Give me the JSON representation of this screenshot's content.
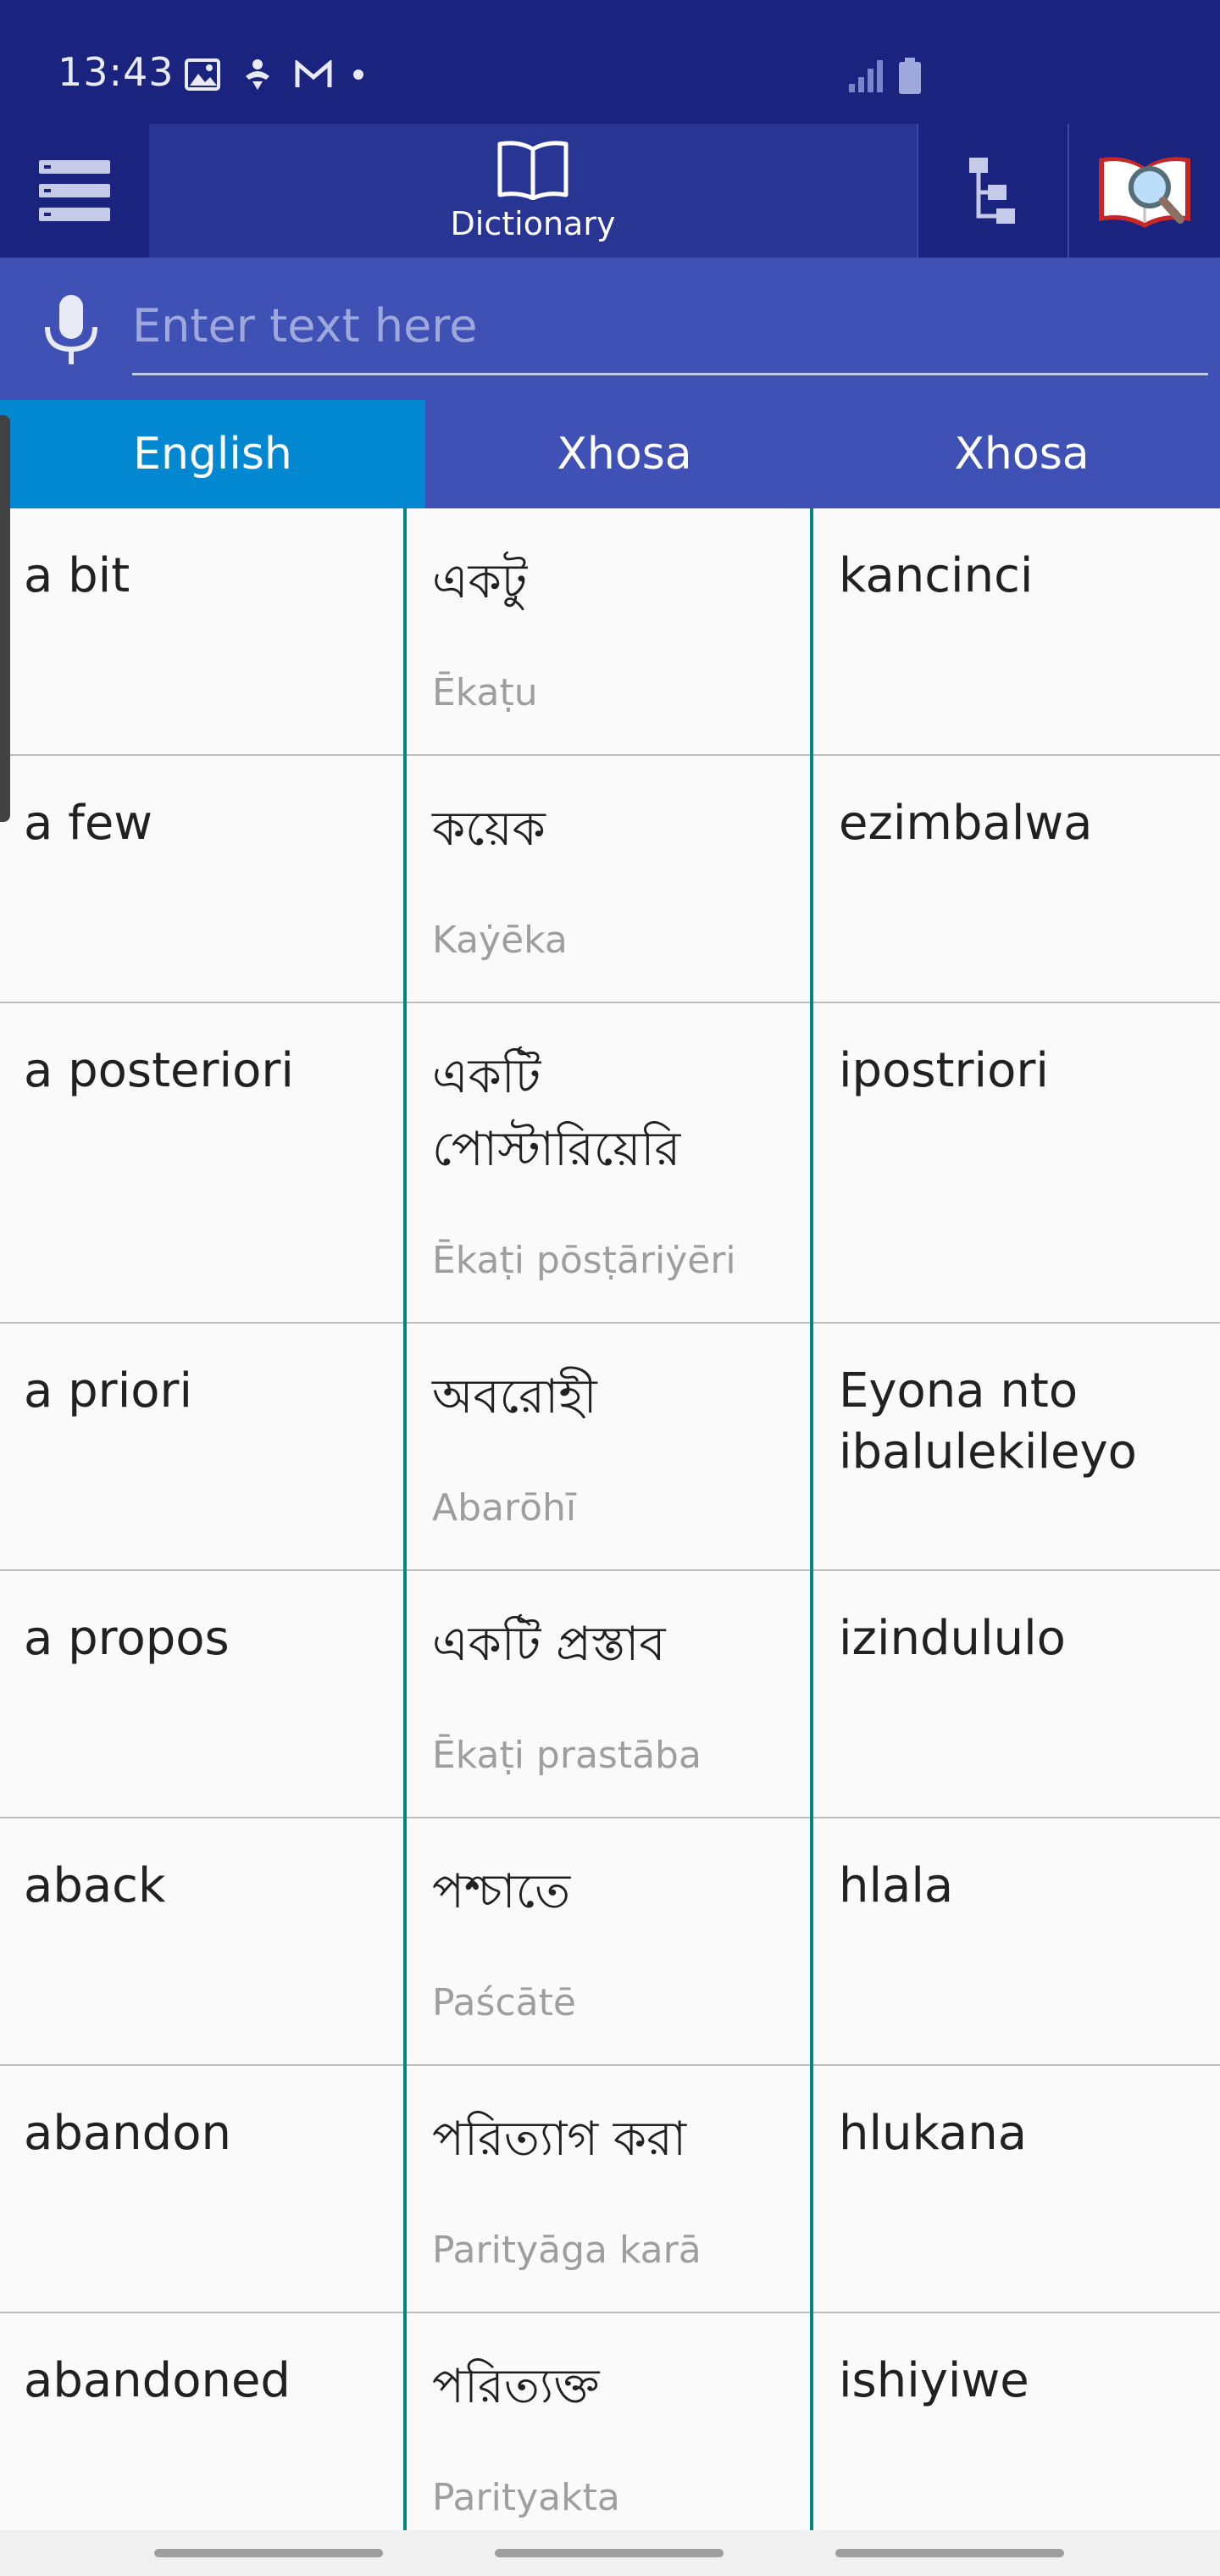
{
  "status_bar": {
    "time": "13:43",
    "left_icons": [
      "image-icon",
      "accessibility-icon",
      "gmail-icon",
      "dot-icon"
    ],
    "right_icons": [
      "signal-icon",
      "battery-icon"
    ]
  },
  "toolbar": {
    "menu_icon": "menu-icon",
    "dictionary_label": "Dictionary",
    "dictionary_icon": "book-icon",
    "tree_icon": "tree-icon",
    "lookup_icon": "book-magnifier-icon"
  },
  "search": {
    "placeholder": "Enter text here",
    "value": "",
    "mic_icon": "mic-icon"
  },
  "languages": [
    {
      "label": "English",
      "active": true
    },
    {
      "label": "Xhosa",
      "active": false
    },
    {
      "label": "Xhosa",
      "active": false
    }
  ],
  "rows": [
    {
      "english": "a bit",
      "bengali": "একটু",
      "translit": "Ēkaṭu",
      "xhosa": "kancinci"
    },
    {
      "english": "a few",
      "bengali": "কয়েক",
      "translit": "Kaẏēka",
      "xhosa": "ezimbalwa"
    },
    {
      "english": "a posteriori",
      "bengali": "একটি\nপোস্টারিয়েরি",
      "translit": "Ēkaṭi pōsṭāriẏēri",
      "xhosa": "ipostriori"
    },
    {
      "english": "a priori",
      "bengali": "অবরোহী",
      "translit": "Abarōhī",
      "xhosa": "Eyona nto ibalulekileyo"
    },
    {
      "english": "a propos",
      "bengali": "একটি প্রস্তাব",
      "translit": "Ēkaṭi prastāba",
      "xhosa": "izindululo"
    },
    {
      "english": "aback",
      "bengali": "পশ্চাতে",
      "translit": "Paścātē",
      "xhosa": "hlala"
    },
    {
      "english": "abandon",
      "bengali": "পরিত্যাগ করা",
      "translit": "Parityāga karā",
      "xhosa": "hlukana"
    },
    {
      "english": "abandoned",
      "bengali": "পরিত্যক্ত",
      "translit": "Parityakta",
      "xhosa": "ishiyiwe"
    }
  ],
  "colors": {
    "status_bar": "#1a237e",
    "toolbar": "#1a237e",
    "dictionary_tab": "#283593",
    "search_bar": "#3f51b5",
    "active_language": "#0288d1",
    "column_divider": "#00897b"
  }
}
